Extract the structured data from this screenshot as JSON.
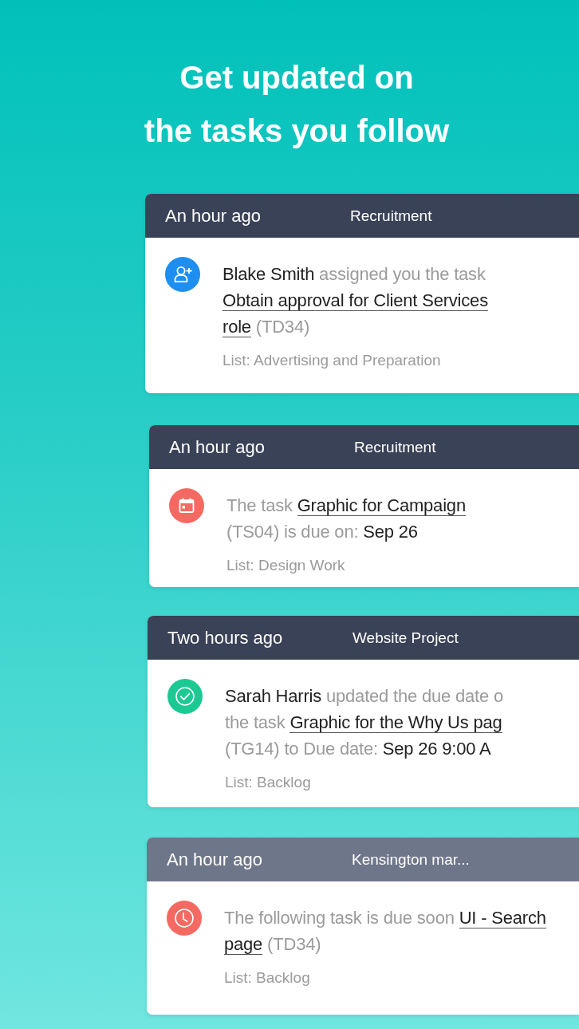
{
  "headline": "Get updated on\nthe tasks you follow",
  "notifications": [
    {
      "kind": "assigned",
      "time": "An hour ago",
      "project": "Recruitment",
      "dimmed": false,
      "color": "#1e8ef0",
      "message": [
        [
          {
            "kind": "name",
            "text": "Blake Smith"
          },
          {
            "kind": "text",
            "text": "assigned you the task"
          }
        ],
        [
          {
            "kind": "link",
            "text": "Obtain approval for Client Services"
          }
        ],
        [
          {
            "kind": "link",
            "text": "role"
          },
          {
            "kind": "text",
            "text": "(TD34)"
          }
        ]
      ],
      "list": "List: Advertising and Preparation"
    },
    {
      "kind": "due",
      "time": "An hour ago",
      "project": "Recruitment",
      "dimmed": false,
      "color": "#f46a62",
      "message": [
        [
          {
            "kind": "text",
            "text": "The task"
          },
          {
            "kind": "link",
            "text": "Graphic for Campaign"
          }
        ],
        [
          {
            "kind": "text",
            "text": "(TS04) is due on:"
          },
          {
            "kind": "date",
            "text": "Sep 26"
          }
        ]
      ],
      "list": "List: Design Work"
    },
    {
      "kind": "updated",
      "time": "Two hours ago",
      "project": "Website Project",
      "dimmed": false,
      "color": "#1dc993",
      "message": [
        [
          {
            "kind": "name",
            "text": "Sarah Harris"
          },
          {
            "kind": "text",
            "text": "updated the due date o"
          }
        ],
        [
          {
            "kind": "text",
            "text": "the task"
          },
          {
            "kind": "link",
            "text": "Graphic for the Why Us pag"
          }
        ],
        [
          {
            "kind": "text",
            "text": "(TG14) to Due date:"
          },
          {
            "kind": "date",
            "text": "Sep 26 9:00 A"
          }
        ]
      ],
      "list": "List: Backlog"
    },
    {
      "kind": "reminder",
      "time": "An hour ago",
      "project": "Kensington mar...",
      "dimmed": true,
      "color": "#f46a62",
      "message": [
        [
          {
            "kind": "text",
            "text": "The following task is due soon"
          },
          {
            "kind": "link",
            "text": "UI - Search"
          }
        ],
        [
          {
            "kind": "link",
            "text": "page"
          },
          {
            "kind": "text",
            "text": "(TD34)"
          }
        ]
      ],
      "list": "List: Backlog"
    }
  ]
}
